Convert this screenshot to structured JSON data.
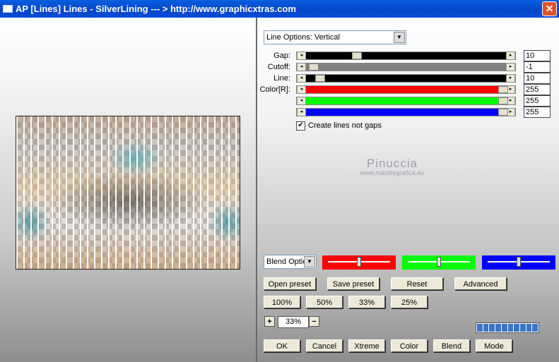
{
  "window": {
    "title": "AP [Lines]  Lines - SilverLining    --- > http://www.graphicxtras.com",
    "close_glyph": "✕"
  },
  "options": {
    "select_label": "Line Options: Vertical"
  },
  "sliders": [
    {
      "label": "Gap:",
      "value": "10",
      "level": 0.24,
      "color": "#000000"
    },
    {
      "label": "Cutoff:",
      "value": "-1",
      "level": 0.02,
      "color": "#808080"
    },
    {
      "label": "Line:",
      "value": "10",
      "level": 0.05,
      "color": "#000000"
    },
    {
      "label": "Color[R]:",
      "value": "255",
      "level": 1.0,
      "color": "#ff0000"
    },
    {
      "label": "",
      "value": "255",
      "level": 1.0,
      "color": "#00ff00"
    },
    {
      "label": "",
      "value": "255",
      "level": 1.0,
      "color": "#0000ff"
    }
  ],
  "checkbox": {
    "label": "Create lines not gaps",
    "checked": "✔"
  },
  "watermark": {
    "name": "Pinuccia",
    "site": "www.maidiregrafica.eu"
  },
  "blend": {
    "label": "Blend Optic"
  },
  "color_boxes": [
    {
      "name": "red",
      "color": "#ff0000",
      "level": 0.5
    },
    {
      "name": "green",
      "color": "#00ff00",
      "level": 0.5
    },
    {
      "name": "blue",
      "color": "#0000ff",
      "level": 0.5
    }
  ],
  "buttons": {
    "open_preset": "Open preset",
    "save_preset": "Save preset",
    "reset": "Reset",
    "advanced": "Advanced",
    "z100": "100%",
    "z50": "50%",
    "z33": "33%",
    "z25": "25%",
    "ok": "OK",
    "cancel": "Cancel",
    "xtreme": "Xtreme",
    "color": "Color",
    "blend": "Blend",
    "mode": "Mode"
  },
  "zoom": {
    "plus": "+",
    "value": "33%",
    "minus": "−"
  },
  "progress": {
    "segments": 10
  }
}
